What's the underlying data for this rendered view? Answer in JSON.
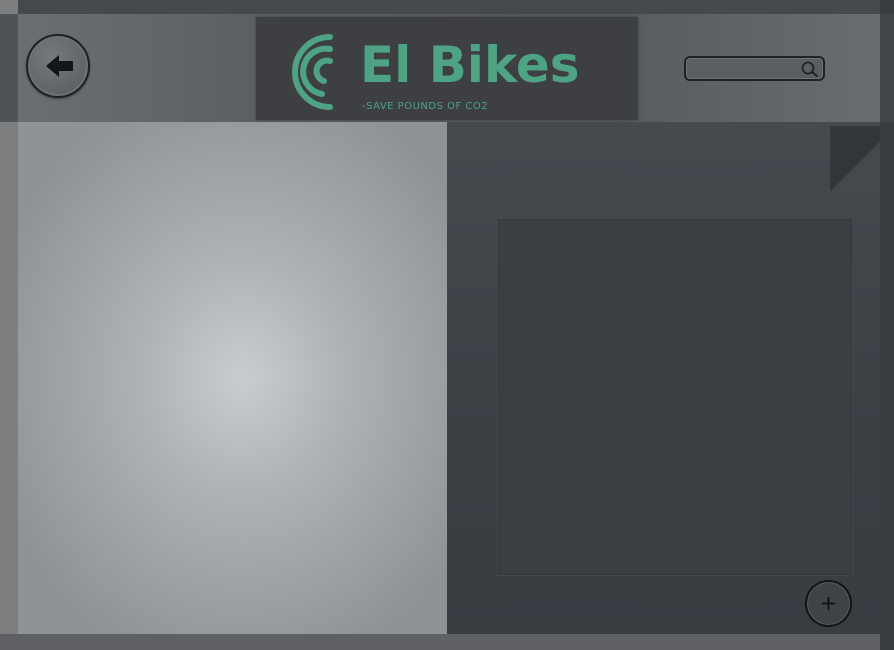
{
  "header": {
    "brand_name": "El Bikes",
    "tagline": "-SAVE POUNDS OF CO2",
    "back_icon": "arrow-left-icon",
    "search": {
      "value": "",
      "placeholder": "",
      "icon": "search-icon"
    }
  },
  "content": {
    "add_icon": "plus-icon"
  },
  "colors": {
    "brand": "#4ea384",
    "logo_background": "#3d3f42",
    "header": "#5b5f63",
    "left_panel": "#aeb1b5",
    "right_panel": "#3c4045"
  }
}
